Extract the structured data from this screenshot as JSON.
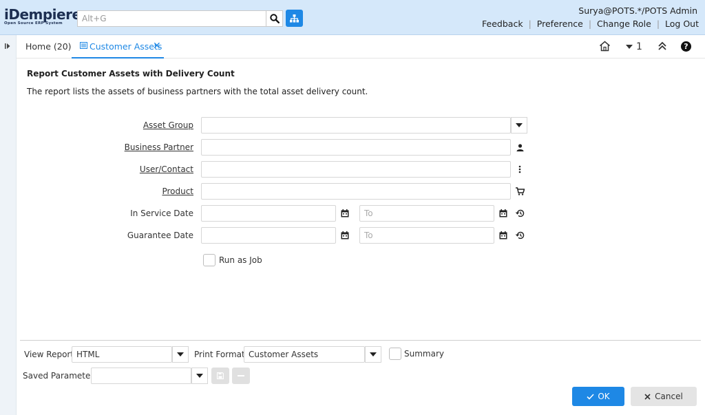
{
  "app": {
    "logo_main": "iDempiere",
    "logo_sub": "Open Source ERP System",
    "search_placeholder": "Alt+G",
    "user": "Surya@POTS.*/POTS Admin",
    "links": [
      "Feedback",
      "Preference",
      "Change Role",
      "Log Out"
    ]
  },
  "tabs": {
    "home": "Home (20)",
    "active": "Customer Assets",
    "window_count": "1"
  },
  "report": {
    "title": "Report Customer Assets with Delivery Count",
    "description": "The report lists the assets of business partners with the total asset delivery count."
  },
  "params": {
    "asset_group": {
      "label": "Asset Group",
      "value": ""
    },
    "business_partner": {
      "label": "Business Partner",
      "value": ""
    },
    "user_contact": {
      "label": "User/Contact",
      "value": ""
    },
    "product": {
      "label": "Product",
      "value": ""
    },
    "in_service_date": {
      "label": "In Service Date",
      "from": "",
      "to_placeholder": "To"
    },
    "guarantee_date": {
      "label": "Guarantee Date",
      "from": "",
      "to_placeholder": "To"
    },
    "run_as_job": {
      "label": "Run as Job",
      "checked": false
    }
  },
  "bottom": {
    "view_report_label": "View Report",
    "view_report_value": "HTML",
    "print_format_label": "Print Format",
    "print_format_value": "Customer Assets",
    "summary_label": "Summary",
    "saved_params_label": "Saved Parameters",
    "saved_params_value": "",
    "ok_label": "OK",
    "cancel_label": "Cancel"
  },
  "colors": {
    "header_bg": "#d5e8fa",
    "accent": "#1e88e5"
  }
}
